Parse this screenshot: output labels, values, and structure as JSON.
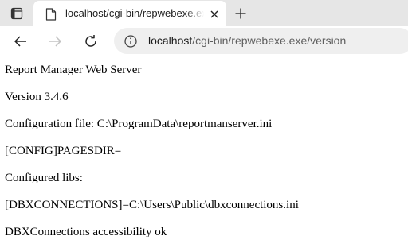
{
  "browser": {
    "tab": {
      "title": "localhost/cgi-bin/repwebexe.exe/version"
    },
    "address_bar": {
      "host": "localhost",
      "path": "/cgi-bin/repwebexe.exe/version"
    },
    "icons": {
      "tab_actions": "tab-actions-icon",
      "favicon": "document-icon",
      "close": "close-icon",
      "new_tab": "plus-icon",
      "back": "arrow-left-icon",
      "forward": "arrow-right-icon",
      "refresh": "refresh-icon",
      "site_info": "info-icon"
    }
  },
  "page": {
    "lines": [
      "Report Manager Web Server",
      "Version 3.4.6",
      "Configuration file: C:\\ProgramData\\reportmanserver.ini",
      "[CONFIG]PAGESDIR=",
      "Configured libs:",
      "[DBXCONNECTIONS]=C:\\Users\\Public\\dbxconnections.ini",
      "DBXConnections accessibility ok"
    ]
  }
}
